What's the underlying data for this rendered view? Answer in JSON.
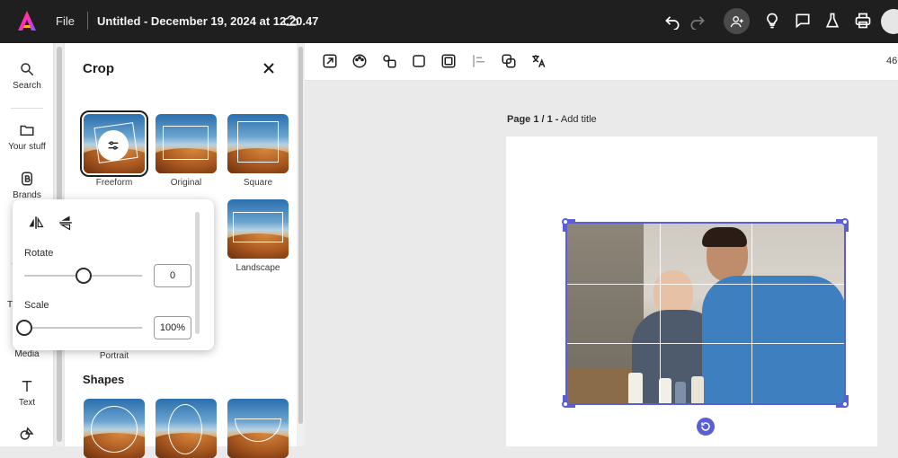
{
  "topbar": {
    "file_label": "File",
    "doc_title": "Untitled - December 19, 2024 at 12.20.47"
  },
  "rail": {
    "items": [
      {
        "label": "Search",
        "icon": "search-icon"
      },
      {
        "label": "Your stuff",
        "icon": "folder-icon"
      },
      {
        "label": "Brands",
        "icon": "brands-icon"
      },
      {
        "label": "T",
        "icon": "templates-icon"
      },
      {
        "label": "Media",
        "icon": "media-icon"
      },
      {
        "label": "Text",
        "icon": "text-icon"
      },
      {
        "label": "",
        "icon": "elements-icon"
      }
    ]
  },
  "panel": {
    "title": "Crop",
    "crop_options": [
      {
        "label": "Freeform"
      },
      {
        "label": "Original"
      },
      {
        "label": "Square"
      },
      {
        "label": "Landscape"
      },
      {
        "label": "Portrait"
      }
    ],
    "shapes_title": "Shapes"
  },
  "popover": {
    "rotate_label": "Rotate",
    "rotate_value": "0",
    "rotate_fraction": 0.5,
    "scale_label": "Scale",
    "scale_value": "100%",
    "scale_fraction": 0.0
  },
  "toolbar": {
    "zoom_partial": "46"
  },
  "canvas": {
    "page_label_bold": "Page 1 / 1 -",
    "page_label_rest": " Add title"
  },
  "colors": {
    "topbar_bg": "#1f1f1f",
    "selection": "#5a5fd6"
  }
}
